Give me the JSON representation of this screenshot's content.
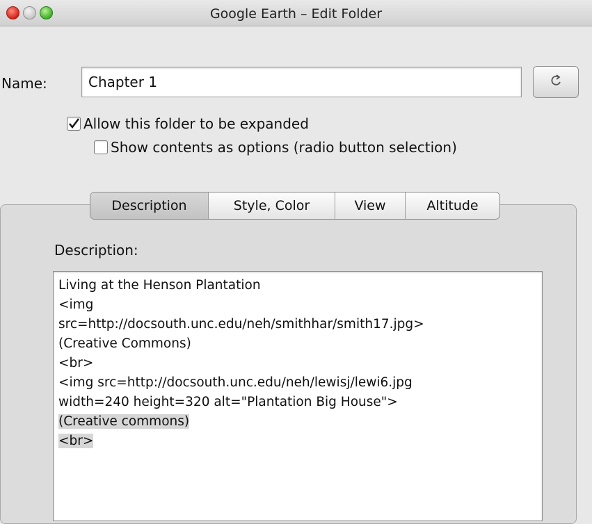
{
  "window": {
    "title": "Google Earth – Edit Folder"
  },
  "name_field": {
    "label": "Name:",
    "value": "Chapter 1",
    "button_icon": "refresh-arrow-icon"
  },
  "options": {
    "allow_expand": {
      "label": "Allow this folder to be expanded",
      "checked": true
    },
    "show_as_options": {
      "label": "Show contents as options (radio button selection)",
      "checked": false
    }
  },
  "tabs": [
    {
      "label": "Description",
      "active": true
    },
    {
      "label": "Style, Color",
      "active": false
    },
    {
      "label": "View",
      "active": false
    },
    {
      "label": "Altitude",
      "active": false
    }
  ],
  "description": {
    "label": "Description:",
    "lines": [
      {
        "text": "Living at the Henson Plantation",
        "selected": false
      },
      {
        "text": "<img",
        "selected": false
      },
      {
        "text": "src=http://docsouth.unc.edu/neh/smithhar/smith17.jpg>",
        "selected": false
      },
      {
        "text": "(Creative Commons)",
        "selected": false
      },
      {
        "text": "<br>",
        "selected": false
      },
      {
        "text": "<img src=http://docsouth.unc.edu/neh/lewisj/lewi6.jpg",
        "selected": false
      },
      {
        "text": "width=240 height=320 alt=\"Plantation Big House\">",
        "selected": false
      },
      {
        "text": "(Creative commons)",
        "selected": true
      },
      {
        "text": "<br>",
        "selected": true
      }
    ]
  }
}
